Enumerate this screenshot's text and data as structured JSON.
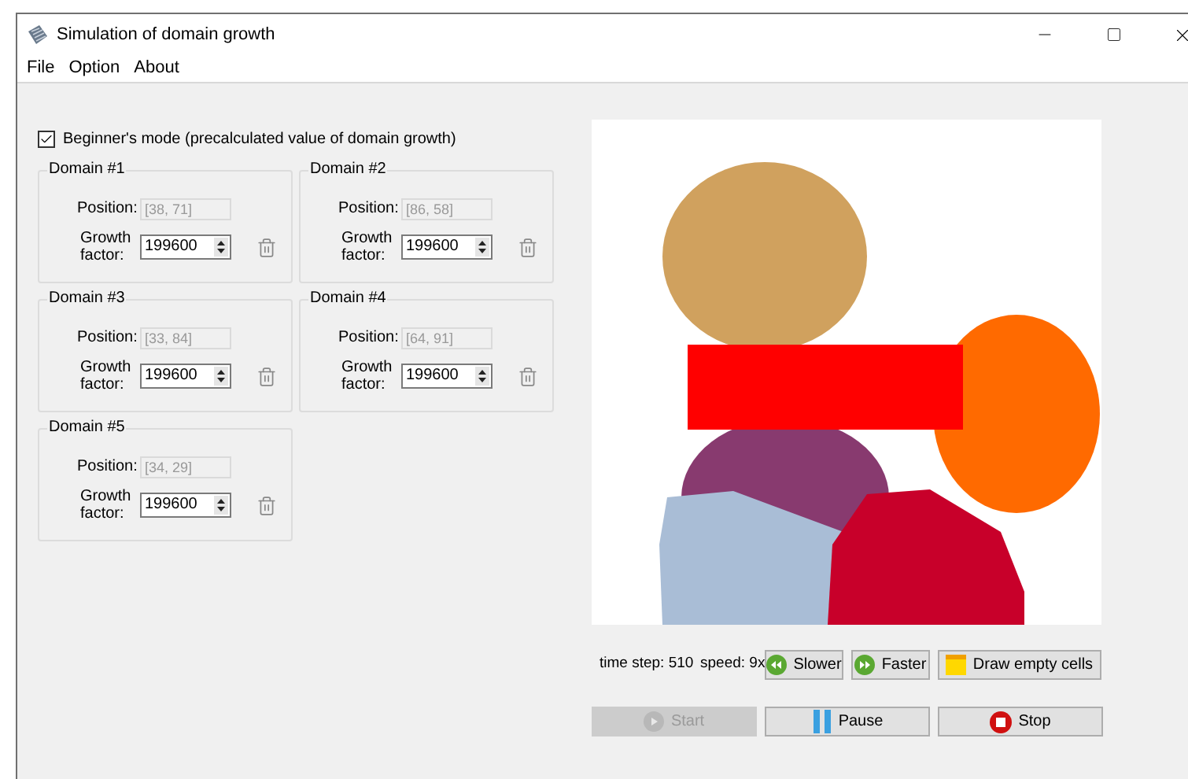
{
  "window": {
    "title": "Simulation of domain growth"
  },
  "menu": [
    {
      "label": "File"
    },
    {
      "label": "Option"
    },
    {
      "label": "About"
    }
  ],
  "beginners_mode": {
    "label": "Beginner's mode (precalculated value of domain growth)",
    "checked": true
  },
  "domains": [
    {
      "title": "Domain #1",
      "position_label": "Position:",
      "position": "[38, 71]",
      "growth_label": "Growth factor:",
      "growth_factor": "199600"
    },
    {
      "title": "Domain #2",
      "position_label": "Position:",
      "position": "[86, 58]",
      "growth_label": "Growth factor:",
      "growth_factor": "199600"
    },
    {
      "title": "Domain #3",
      "position_label": "Position:",
      "position": "[33, 84]",
      "growth_label": "Growth factor:",
      "growth_factor": "199600"
    },
    {
      "title": "Domain #4",
      "position_label": "Position:",
      "position": "[64, 91]",
      "growth_label": "Growth factor:",
      "growth_factor": "199600"
    },
    {
      "title": "Domain #5",
      "position_label": "Position:",
      "position": "[34, 29]",
      "growth_label": "Growth factor:",
      "growth_factor": "199600"
    }
  ],
  "status": {
    "time_step": "time step: 510",
    "speed": "speed: 9x"
  },
  "speed_buttons": [
    {
      "kind": "slower",
      "label": "Slower",
      "disabled": false
    },
    {
      "kind": "faster",
      "label": "Faster",
      "disabled": false
    },
    {
      "kind": "cells",
      "label": "Draw empty cells",
      "disabled": false
    }
  ],
  "control_buttons": [
    {
      "kind": "start",
      "label": "Start",
      "disabled": true
    },
    {
      "kind": "pause",
      "label": "Pause",
      "disabled": false
    },
    {
      "kind": "stop",
      "label": "Stop",
      "disabled": false
    }
  ]
}
